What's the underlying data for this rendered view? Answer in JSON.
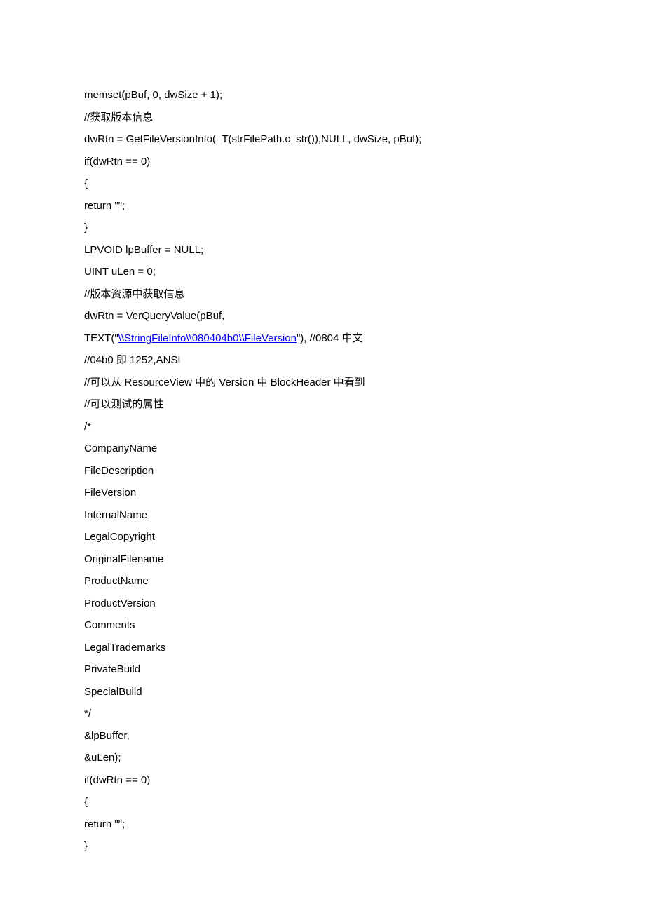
{
  "lines": [
    {
      "text": "memset(pBuf, 0, dwSize + 1);"
    },
    {
      "text": "//获取版本信息"
    },
    {
      "text": "dwRtn = GetFileVersionInfo(_T(strFilePath.c_str()),NULL, dwSize, pBuf);"
    },
    {
      "text": "if(dwRtn == 0)"
    },
    {
      "text": "{"
    },
    {
      "text": "return \"\";"
    },
    {
      "text": "}"
    },
    {
      "text": ""
    },
    {
      "text": "LPVOID lpBuffer = NULL;"
    },
    {
      "text": "UINT uLen = 0;"
    },
    {
      "text": "//版本资源中获取信息"
    },
    {
      "text": "dwRtn = VerQueryValue(pBuf,"
    },
    {
      "prefix": "TEXT(\"",
      "link": "\\\\StringFileInfo\\\\080404b0\\\\FileVersion",
      "suffix": "\"), //0804 中文"
    },
    {
      "text": "//04b0 即 1252,ANSI"
    },
    {
      "text": "//可以从 ResourceView 中的 Version 中 BlockHeader 中看到"
    },
    {
      "text": "//可以测试的属性"
    },
    {
      "text": "/*"
    },
    {
      "text": "CompanyName"
    },
    {
      "text": "FileDescription"
    },
    {
      "text": "FileVersion"
    },
    {
      "text": "InternalName"
    },
    {
      "text": "LegalCopyright"
    },
    {
      "text": "OriginalFilename"
    },
    {
      "text": "ProductName"
    },
    {
      "text": "ProductVersion"
    },
    {
      "text": "Comments"
    },
    {
      "text": "LegalTrademarks"
    },
    {
      "text": "PrivateBuild"
    },
    {
      "text": "SpecialBuild"
    },
    {
      "text": "*/"
    },
    {
      "text": "&lpBuffer,"
    },
    {
      "text": "&uLen);"
    },
    {
      "text": "if(dwRtn == 0)"
    },
    {
      "text": "{"
    },
    {
      "text": "return \"\";"
    },
    {
      "text": "}"
    }
  ]
}
